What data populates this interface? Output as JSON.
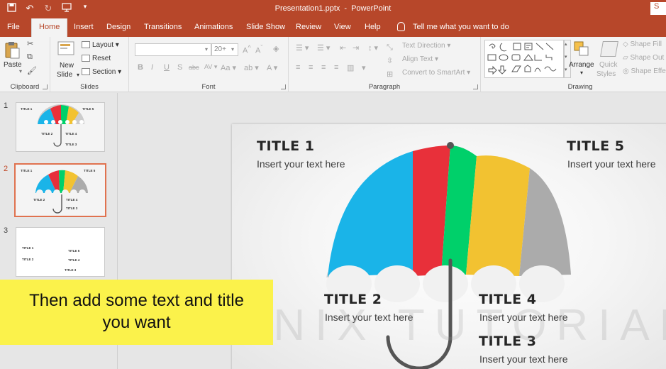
{
  "window": {
    "title": "Presentation1.pptx",
    "separator": "-",
    "app": "PowerPoint",
    "signin": "S"
  },
  "tabs": [
    "File",
    "Home",
    "Insert",
    "Design",
    "Transitions",
    "Animations",
    "Slide Show",
    "Review",
    "View",
    "Help",
    "Tell me what you want to do"
  ],
  "ribbon": {
    "clipboard": {
      "label": "Clipboard",
      "paste": "Paste"
    },
    "slides": {
      "label": "Slides",
      "new_slide_1": "New",
      "new_slide_2": "Slide",
      "layout": "Layout",
      "reset": "Reset",
      "section": "Section"
    },
    "font": {
      "label": "Font",
      "size": "20+"
    },
    "paragraph": {
      "label": "Paragraph",
      "text_direction": "Text Direction",
      "align_text": "Align Text",
      "convert_smartart": "Convert to SmartArt"
    },
    "drawing": {
      "label": "Drawing",
      "arrange": "Arrange",
      "quick_styles_1": "Quick",
      "quick_styles_2": "Styles",
      "shape_fill": "Shape Fill",
      "shape_outline": "Shape Out",
      "shape_effects": "Shape Effe"
    }
  },
  "thumbnails": [
    {
      "number": "1",
      "labels": [
        "TITLE 1",
        "TITLE 5",
        "TITLE 2",
        "TITLE 4",
        "TITLE 3"
      ]
    },
    {
      "number": "2",
      "labels": [
        "TITLE 1",
        "TITLE 5",
        "TITLE 2",
        "TITLE 4",
        "TITLE 3"
      ]
    },
    {
      "number": "3",
      "labels": [
        "TITLE 1",
        "TITLE 5",
        "TITLE 2",
        "TITLE 4",
        "TITLE 3"
      ]
    }
  ],
  "slide": {
    "title1": "TITLE 1",
    "text1": "Insert your text here",
    "title5": "TITLE 5",
    "text5": "Insert your text here",
    "title2": "TITLE 2",
    "text2": "Insert your text here",
    "title4": "TITLE 4",
    "text4": "Insert your text here",
    "title3": "TITLE 3",
    "text3": "Insert your text here",
    "umbrella_colors": [
      "#1ab4e8",
      "#e8303a",
      "#00d06a",
      "#f2c231",
      "#ababab"
    ]
  },
  "watermark": "ENIX TUTORIAL",
  "caption": {
    "line1": "Then add some text and title",
    "line2": "you want"
  }
}
